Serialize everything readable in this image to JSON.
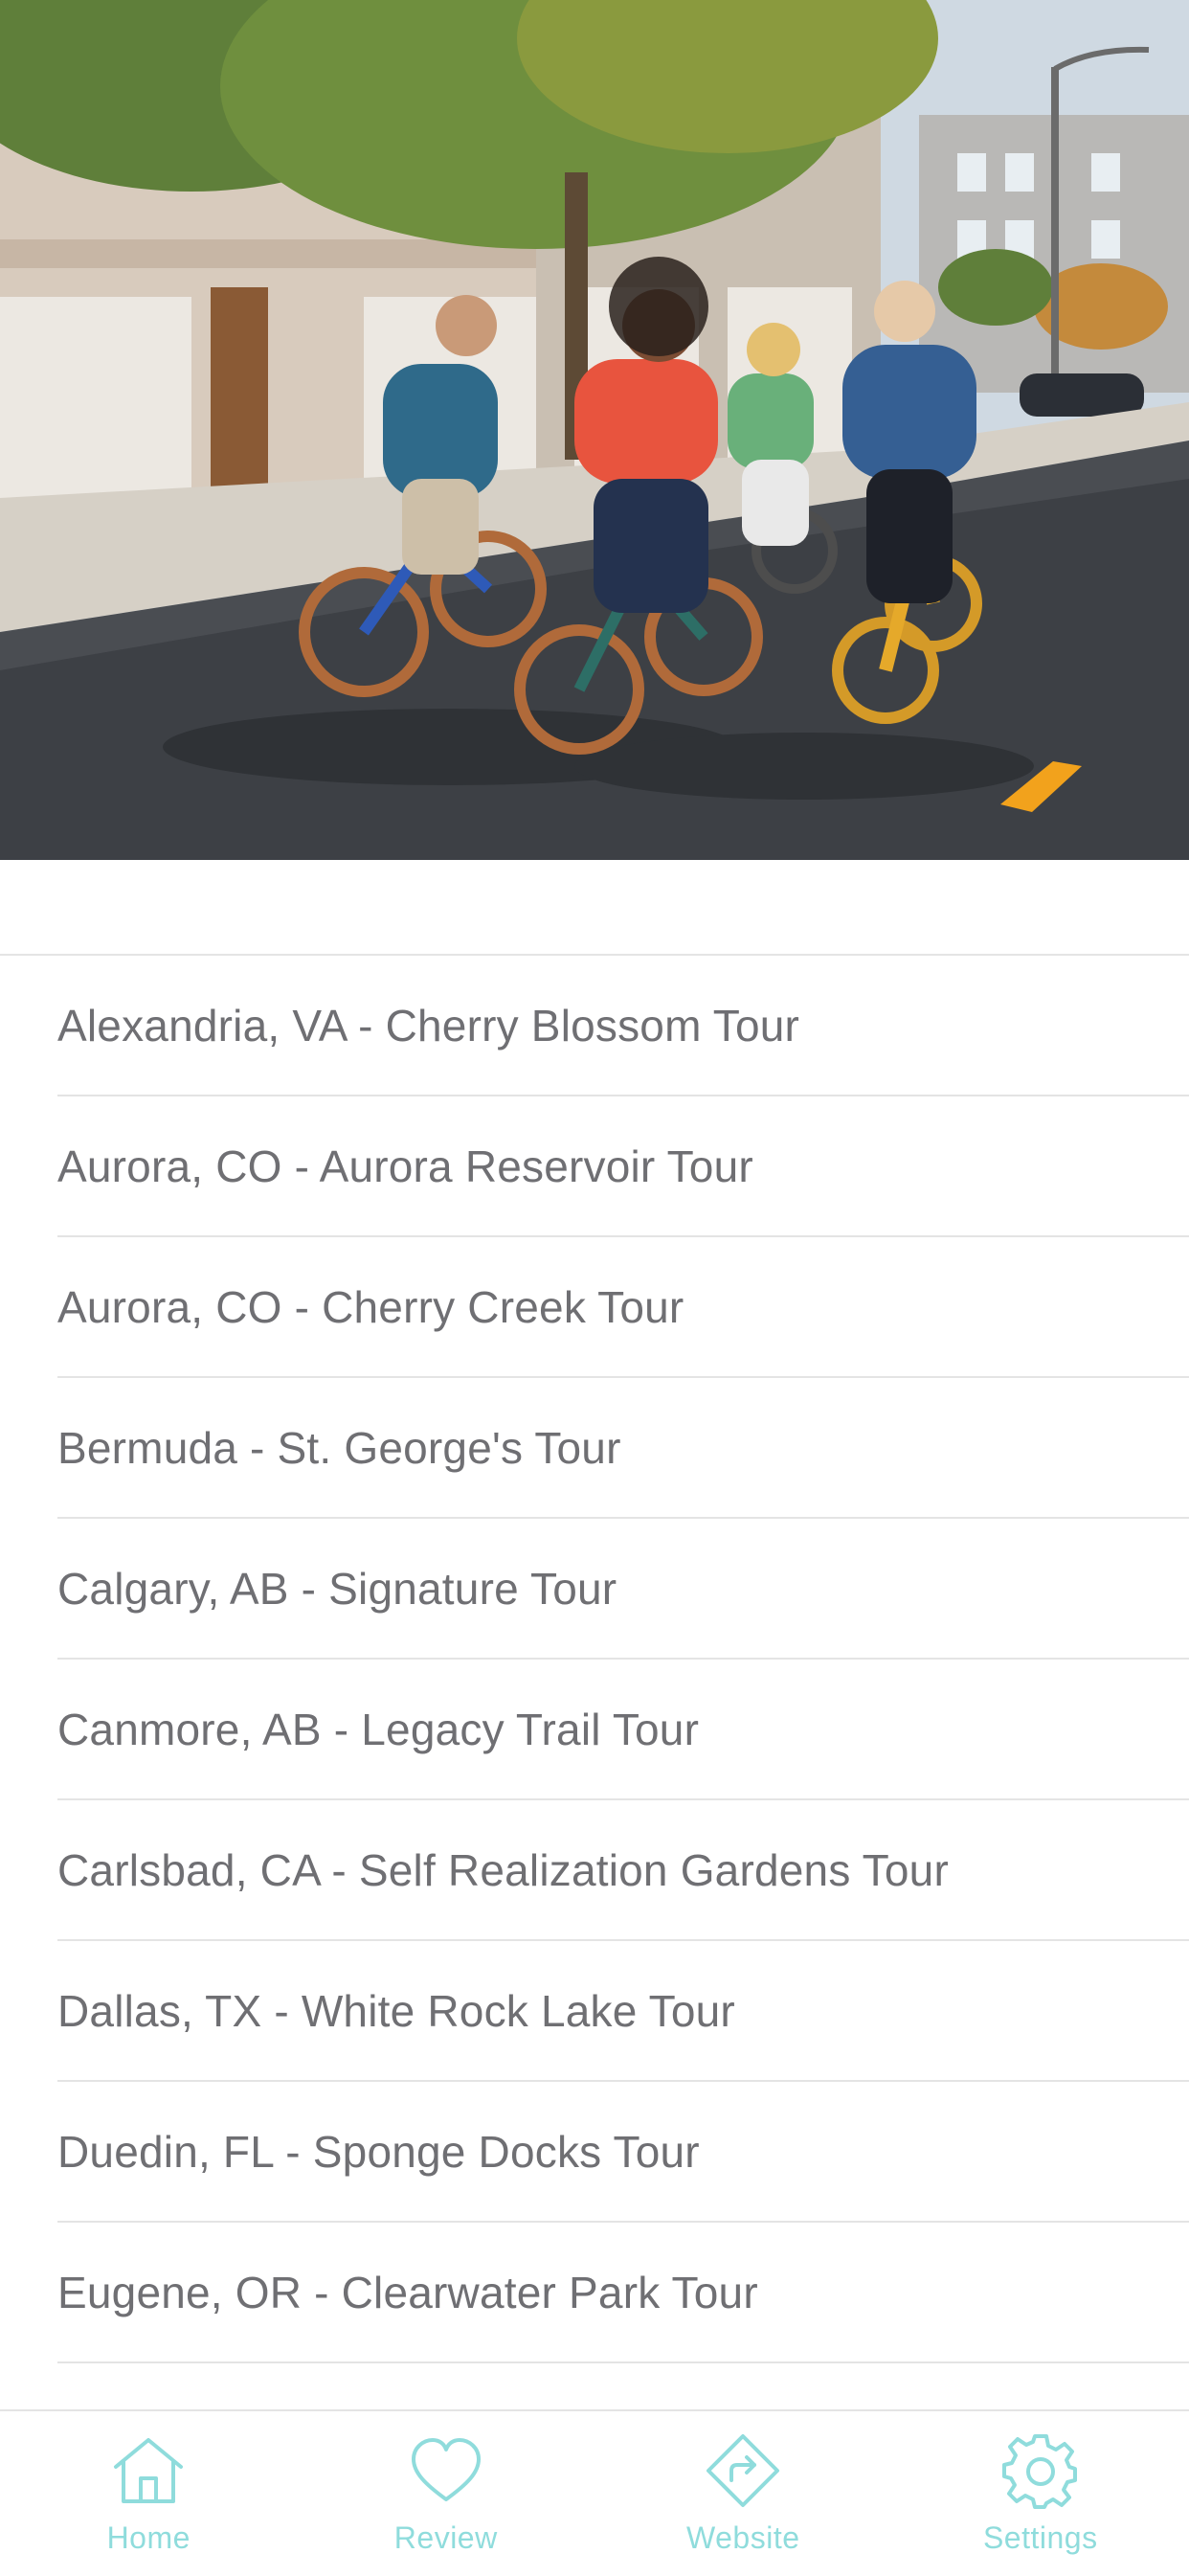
{
  "hero": {
    "image": "group-riding-bicycles-on-street-photo"
  },
  "tours": [
    {
      "label": "Alexandria, VA - Cherry Blossom Tour"
    },
    {
      "label": "Aurora, CO - Aurora Reservoir Tour"
    },
    {
      "label": "Aurora, CO - Cherry Creek Tour"
    },
    {
      "label": "Bermuda - St. George's Tour"
    },
    {
      "label": "Calgary, AB - Signature Tour"
    },
    {
      "label": "Canmore, AB - Legacy Trail Tour"
    },
    {
      "label": "Carlsbad, CA - Self Realization Gardens Tour"
    },
    {
      "label": "Dallas, TX - White Rock Lake Tour"
    },
    {
      "label": "Duedin, FL - Sponge Docks Tour"
    },
    {
      "label": "Eugene, OR - Clearwater Park Tour"
    }
  ],
  "tab_bar": {
    "accent_color": "#8fdcdc",
    "tabs": [
      {
        "label": "Home",
        "icon": "home-icon"
      },
      {
        "label": "Review",
        "icon": "heart-icon"
      },
      {
        "label": "Website",
        "icon": "directions-icon"
      },
      {
        "label": "Settings",
        "icon": "gear-icon"
      }
    ]
  }
}
